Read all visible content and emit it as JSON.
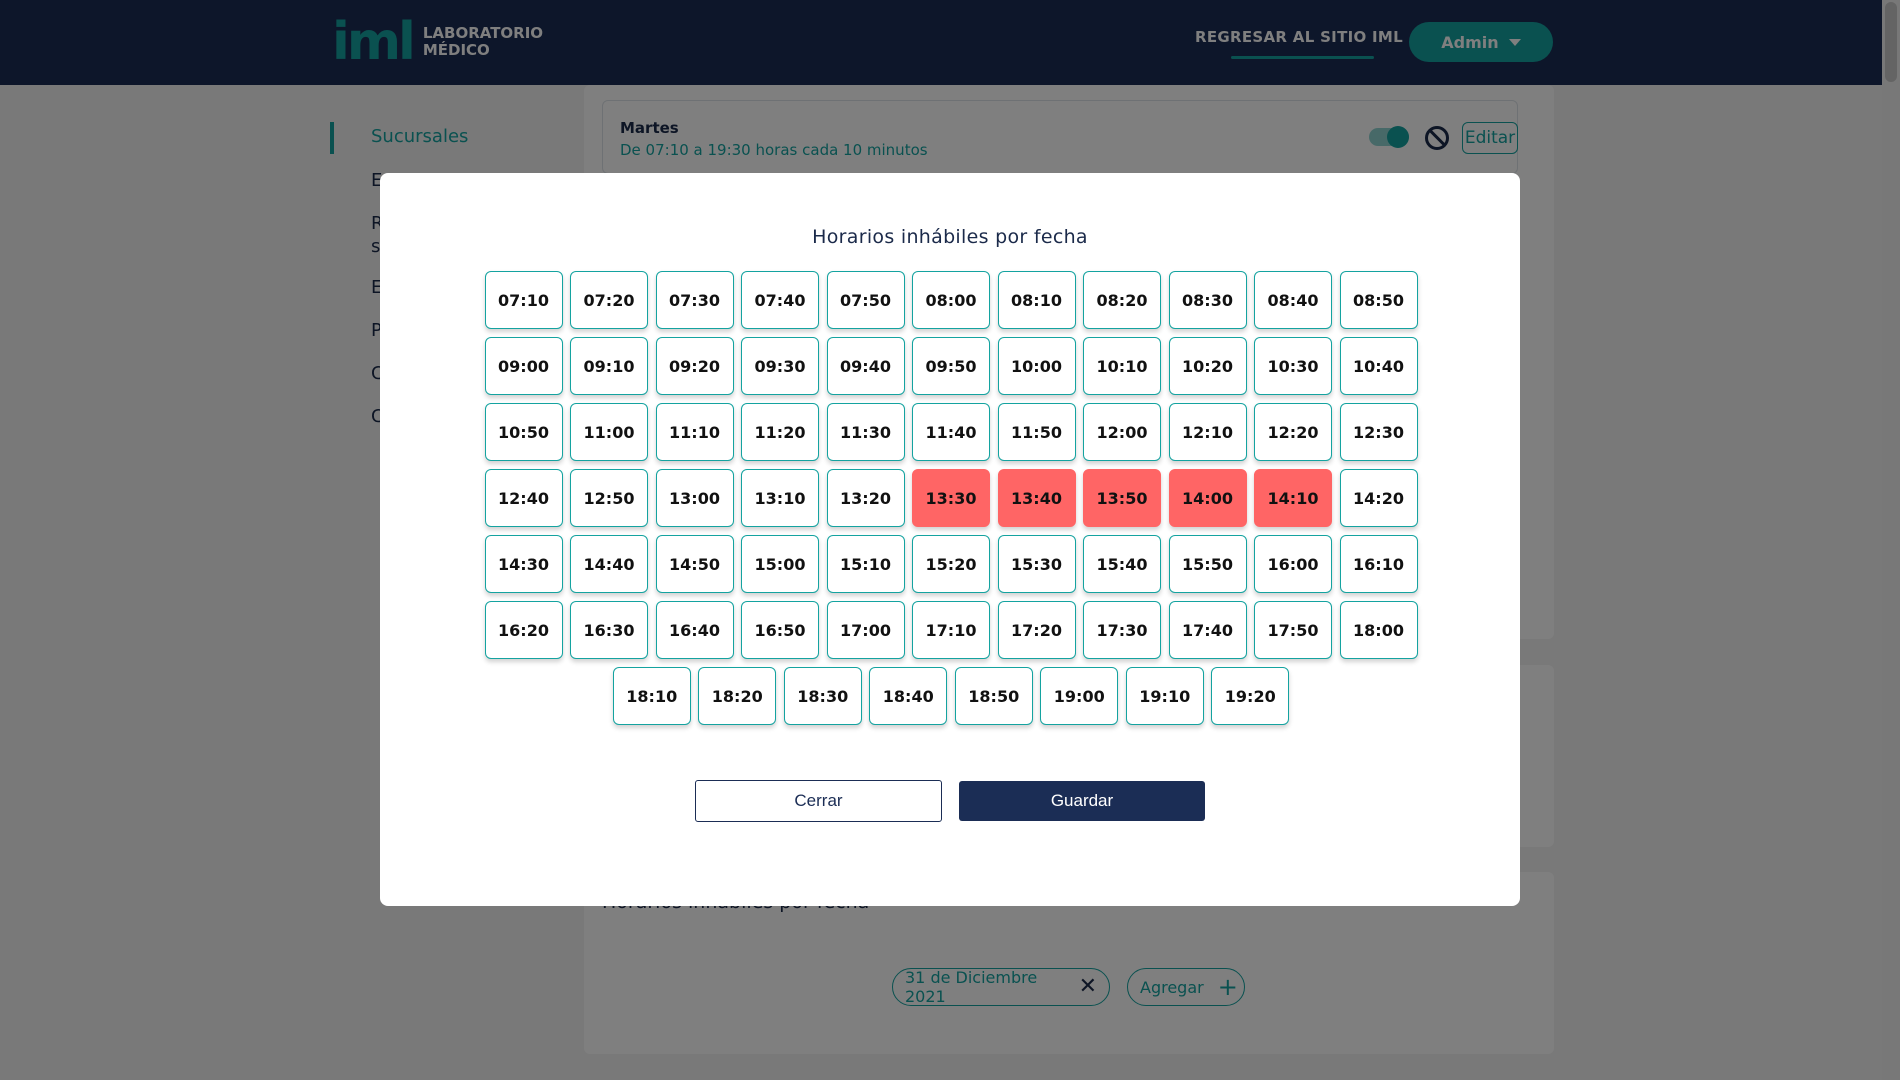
{
  "header": {
    "logo_mark": "iml",
    "logo_line1": "LABORATORIO",
    "logo_line2": "MÉDICO",
    "back_link": "REGRESAR AL SITIO IML",
    "admin_label": "Admin"
  },
  "sidebar": {
    "items": [
      {
        "label": "Sucursales",
        "active": true
      },
      {
        "label": "E"
      },
      {
        "label": "R"
      },
      {
        "label": "s"
      },
      {
        "label": "E"
      },
      {
        "label": "P"
      },
      {
        "label": "C"
      },
      {
        "label": "C"
      }
    ]
  },
  "background": {
    "day_name": "Martes",
    "day_desc": "De 07:10 a 19:30 horas cada 10 minutos",
    "day_enabled": true,
    "edit_label": "Editar",
    "section_title": "Horarios inhábiles por fecha",
    "date_chip": "31 de Diciembre 2021",
    "add_chip": "Agregar"
  },
  "modal": {
    "title": "Horarios inhábiles por fecha",
    "slots": [
      {
        "time": "07:10",
        "blocked": false
      },
      {
        "time": "07:20",
        "blocked": false
      },
      {
        "time": "07:30",
        "blocked": false
      },
      {
        "time": "07:40",
        "blocked": false
      },
      {
        "time": "07:50",
        "blocked": false
      },
      {
        "time": "08:00",
        "blocked": false
      },
      {
        "time": "08:10",
        "blocked": false
      },
      {
        "time": "08:20",
        "blocked": false
      },
      {
        "time": "08:30",
        "blocked": false
      },
      {
        "time": "08:40",
        "blocked": false
      },
      {
        "time": "08:50",
        "blocked": false
      },
      {
        "time": "09:00",
        "blocked": false
      },
      {
        "time": "09:10",
        "blocked": false
      },
      {
        "time": "09:20",
        "blocked": false
      },
      {
        "time": "09:30",
        "blocked": false
      },
      {
        "time": "09:40",
        "blocked": false
      },
      {
        "time": "09:50",
        "blocked": false
      },
      {
        "time": "10:00",
        "blocked": false
      },
      {
        "time": "10:10",
        "blocked": false
      },
      {
        "time": "10:20",
        "blocked": false
      },
      {
        "time": "10:30",
        "blocked": false
      },
      {
        "time": "10:40",
        "blocked": false
      },
      {
        "time": "10:50",
        "blocked": false
      },
      {
        "time": "11:00",
        "blocked": false
      },
      {
        "time": "11:10",
        "blocked": false
      },
      {
        "time": "11:20",
        "blocked": false
      },
      {
        "time": "11:30",
        "blocked": false
      },
      {
        "time": "11:40",
        "blocked": false
      },
      {
        "time": "11:50",
        "blocked": false
      },
      {
        "time": "12:00",
        "blocked": false
      },
      {
        "time": "12:10",
        "blocked": false
      },
      {
        "time": "12:20",
        "blocked": false
      },
      {
        "time": "12:30",
        "blocked": false
      },
      {
        "time": "12:40",
        "blocked": false
      },
      {
        "time": "12:50",
        "blocked": false
      },
      {
        "time": "13:00",
        "blocked": false
      },
      {
        "time": "13:10",
        "blocked": false
      },
      {
        "time": "13:20",
        "blocked": false
      },
      {
        "time": "13:30",
        "blocked": true
      },
      {
        "time": "13:40",
        "blocked": true
      },
      {
        "time": "13:50",
        "blocked": true
      },
      {
        "time": "14:00",
        "blocked": true
      },
      {
        "time": "14:10",
        "blocked": true
      },
      {
        "time": "14:20",
        "blocked": false
      },
      {
        "time": "14:30",
        "blocked": false
      },
      {
        "time": "14:40",
        "blocked": false
      },
      {
        "time": "14:50",
        "blocked": false
      },
      {
        "time": "15:00",
        "blocked": false
      },
      {
        "time": "15:10",
        "blocked": false
      },
      {
        "time": "15:20",
        "blocked": false
      },
      {
        "time": "15:30",
        "blocked": false
      },
      {
        "time": "15:40",
        "blocked": false
      },
      {
        "time": "15:50",
        "blocked": false
      },
      {
        "time": "16:00",
        "blocked": false
      },
      {
        "time": "16:10",
        "blocked": false
      },
      {
        "time": "16:20",
        "blocked": false
      },
      {
        "time": "16:30",
        "blocked": false
      },
      {
        "time": "16:40",
        "blocked": false
      },
      {
        "time": "16:50",
        "blocked": false
      },
      {
        "time": "17:00",
        "blocked": false
      },
      {
        "time": "17:10",
        "blocked": false
      },
      {
        "time": "17:20",
        "blocked": false
      },
      {
        "time": "17:30",
        "blocked": false
      },
      {
        "time": "17:40",
        "blocked": false
      },
      {
        "time": "17:50",
        "blocked": false
      },
      {
        "time": "18:00",
        "blocked": false
      },
      {
        "time": "18:10",
        "blocked": false
      },
      {
        "time": "18:20",
        "blocked": false
      },
      {
        "time": "18:30",
        "blocked": false
      },
      {
        "time": "18:40",
        "blocked": false
      },
      {
        "time": "18:50",
        "blocked": false
      },
      {
        "time": "19:00",
        "blocked": false
      },
      {
        "time": "19:10",
        "blocked": false
      },
      {
        "time": "19:20",
        "blocked": false
      }
    ],
    "close_label": "Cerrar",
    "save_label": "Guardar"
  },
  "colors": {
    "navy": "#1b2d55",
    "teal": "#14a3a0",
    "blocked": "#ff6565"
  }
}
